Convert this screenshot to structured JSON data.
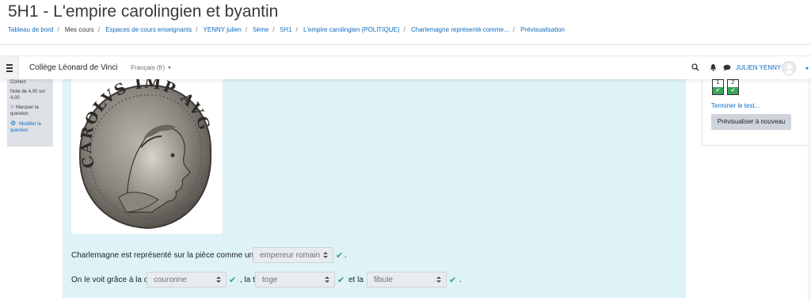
{
  "header": {
    "title": "5H1 - L'empire carolingien et byantin",
    "breadcrumb": [
      "Tableau de bord",
      "Mes cours",
      "Espaces de cours enseignants",
      "YENNY julien",
      "5ème",
      "5H1",
      "L'empire carolingien (POLITIQUE)",
      "Charlemagne représenté comme...",
      "Prévisualisation"
    ]
  },
  "navbar": {
    "site_name": "Collège Léonard de Vinci",
    "language": "Français (fr)",
    "user_name": "JULIEN YENNY",
    "icons": [
      "menu-icon",
      "search-icon",
      "bell-icon",
      "chat-icon",
      "avatar-icon"
    ]
  },
  "question_info": {
    "status": "Correct",
    "grade": "Note de 4,00 sur 4,00",
    "flag_label": "Marquer la question",
    "edit_label": "Modifier la question"
  },
  "question": {
    "line1": {
      "prefix": "Charlemagne est représenté sur la pièce comme un",
      "answer": "empereur romain",
      "suffix": "."
    },
    "line2": {
      "prefix": "On le voit grâce à la c",
      "answer1": "couronne",
      "middle1": ", la t",
      "answer2": "toge",
      "middle2": "et la",
      "answer3": "fibule",
      "suffix": "."
    },
    "coin_legend": "CAROLVS IMP AVG"
  },
  "quiz_nav": {
    "questions": [
      "1",
      "2"
    ],
    "end_test_label": "Terminer le test...",
    "preview_button": "Prévisualiser à nouveau"
  },
  "colors": {
    "link": "#0f6cbf",
    "content_bg": "#def2f8",
    "correct": "#3aa65a"
  }
}
